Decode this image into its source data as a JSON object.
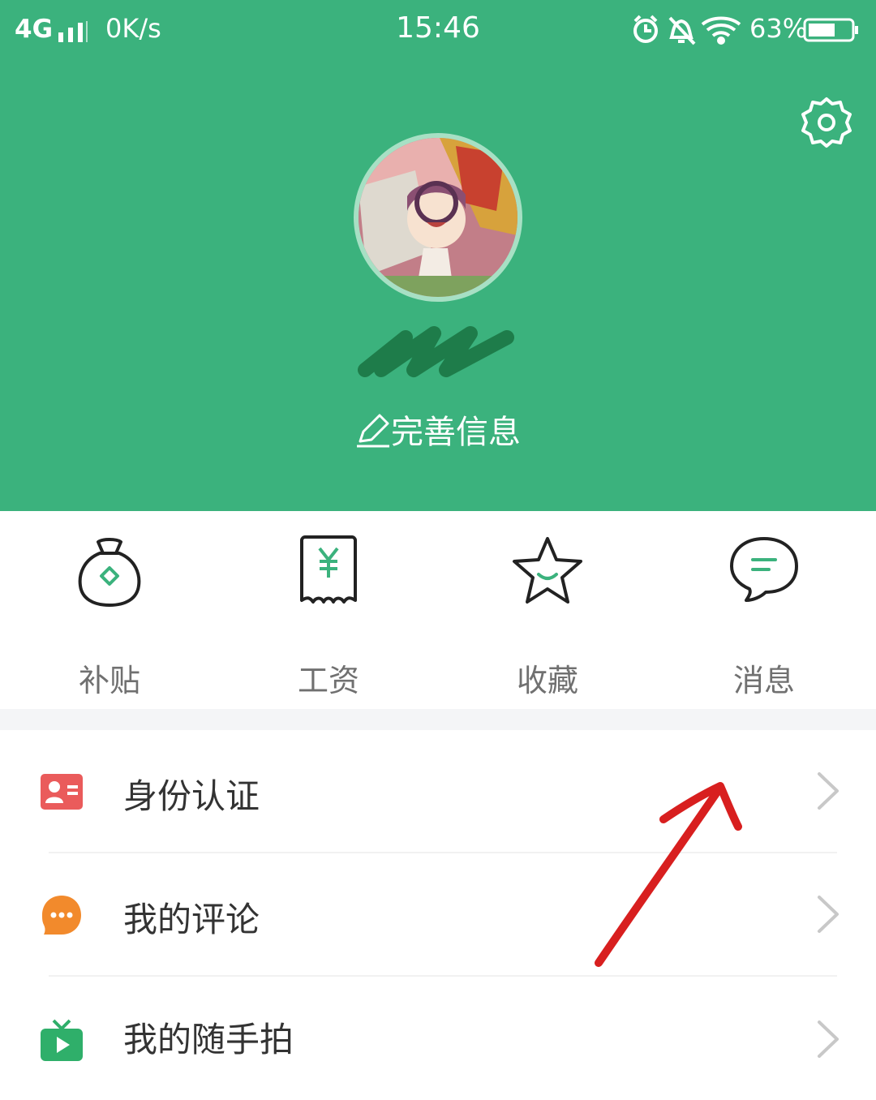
{
  "statusbar": {
    "network": "4G",
    "speed": "0K/s",
    "time": "15:46",
    "battery": "63%",
    "icons": [
      "alarm-icon",
      "mute-icon",
      "wifi-icon",
      "battery-icon"
    ]
  },
  "header": {
    "background": "#3bb27d",
    "settings_icon": "gear-icon",
    "profile_edit_label": "完善信息"
  },
  "quick_actions": [
    {
      "label": "补贴",
      "icon": "money-bag-icon"
    },
    {
      "label": "工资",
      "icon": "receipt-yen-icon"
    },
    {
      "label": "收藏",
      "icon": "star-icon"
    },
    {
      "label": "消息",
      "icon": "chat-bubble-icon"
    }
  ],
  "menu": [
    {
      "label": "身份认证",
      "icon": "id-card-icon",
      "icon_color": "#ea5b5b"
    },
    {
      "label": "我的评论",
      "icon": "comment-icon",
      "icon_color": "#f28a2c"
    },
    {
      "label": "我的随手拍",
      "icon": "tv-icon",
      "icon_color": "#2faf6a"
    }
  ]
}
